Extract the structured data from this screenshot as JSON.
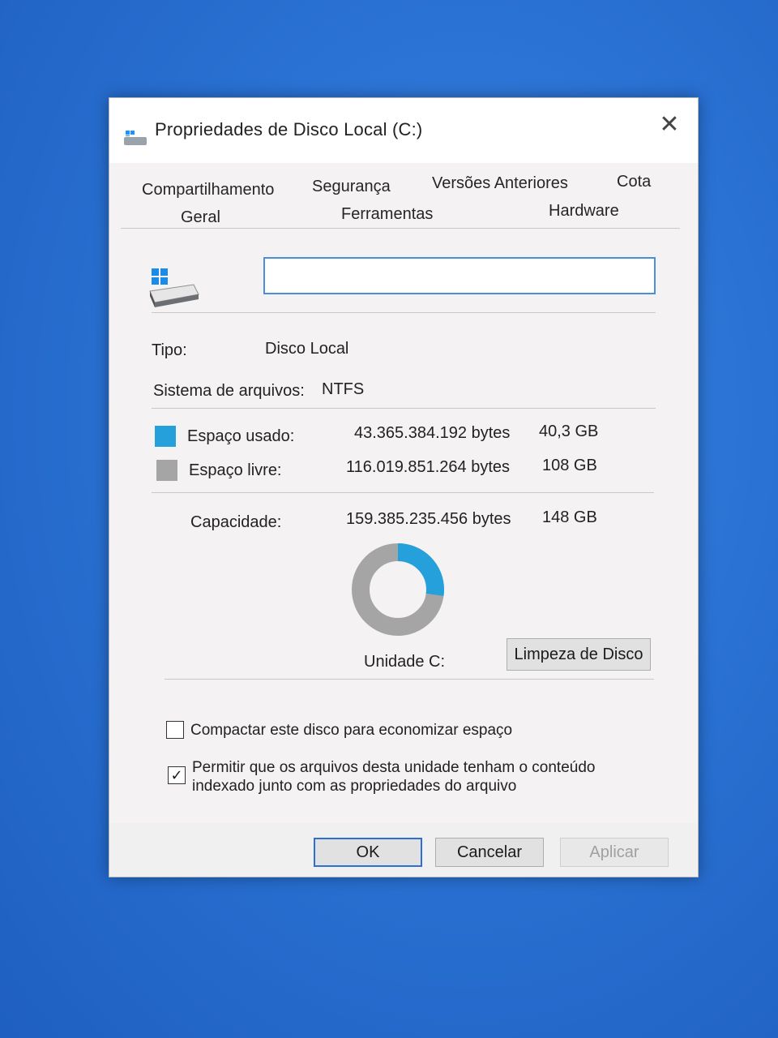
{
  "window": {
    "title": "Propriedades de Disco Local (C:)",
    "close_glyph": "✕"
  },
  "tabs_row1": [
    "Compartilhamento",
    "Segurança",
    "Versões Anteriores",
    "Cota"
  ],
  "tabs_row2": [
    "Geral",
    "Ferramentas",
    "Hardware"
  ],
  "general": {
    "volume_name_value": "",
    "type_label": "Tipo:",
    "type_value": "Disco Local",
    "fs_label": "Sistema de arquivos:",
    "fs_value": "NTFS",
    "used": {
      "label": "Espaço usado:",
      "bytes": "43.365.384.192 bytes",
      "human": "40,3 GB",
      "color": "#26a0da"
    },
    "free": {
      "label": "Espaço livre:",
      "bytes": "116.019.851.264 bytes",
      "human": "108 GB",
      "color": "#a5a5a5"
    },
    "capacity": {
      "label": "Capacidade:",
      "bytes": "159.385.235.456 bytes",
      "human": "148 GB"
    },
    "used_fraction": 0.272,
    "drive_label": "Unidade C:",
    "cleanup_button": "Limpeza de Disco",
    "compress": {
      "label": "Compactar este disco para economizar espaço",
      "checked": false
    },
    "index": {
      "label": "Permitir que os arquivos desta unidade tenham o conteúdo indexado junto com as propriedades do arquivo",
      "checked": true
    }
  },
  "buttons": {
    "ok": "OK",
    "cancel": "Cancelar",
    "apply": "Aplicar"
  },
  "icons": {
    "title": "drive-icon",
    "drive": "windows-drive-icon",
    "close": "close-icon"
  }
}
